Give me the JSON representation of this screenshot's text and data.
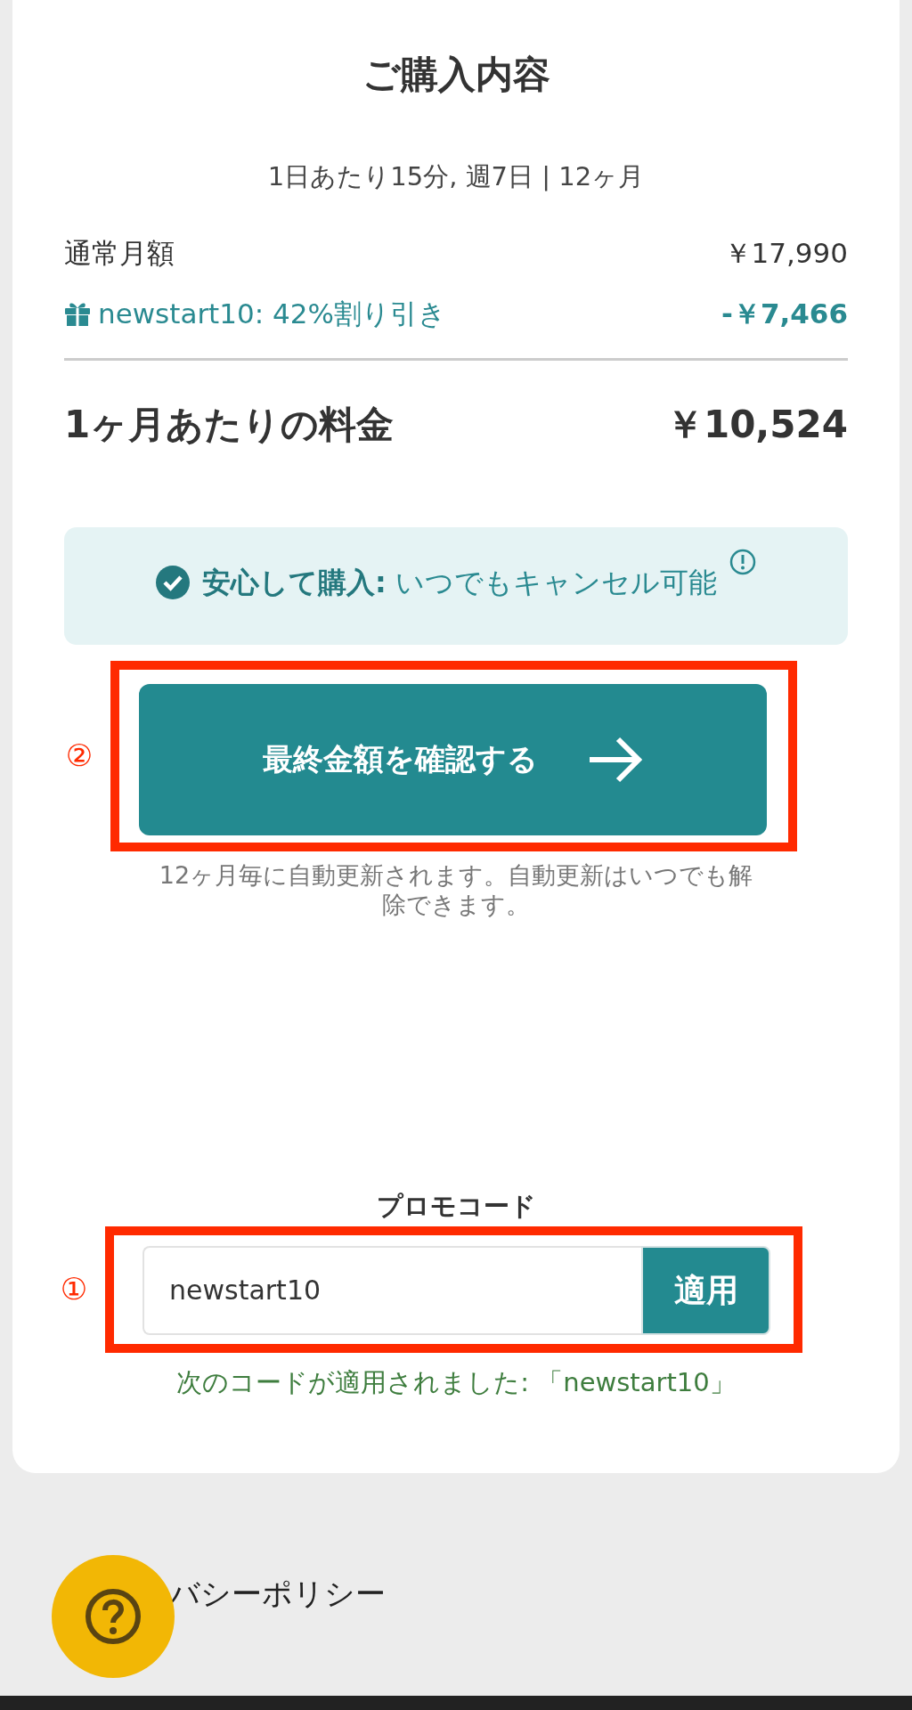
{
  "summary": {
    "title": "ご購入内容",
    "plan": "1日あたり15分, 週7日 | 12ヶ月",
    "lines": [
      {
        "kind": "regular",
        "label": "通常月額",
        "amount": "￥17,990"
      },
      {
        "kind": "discount",
        "label": "newstart10: 42%割り引き",
        "amount": "-￥7,466"
      }
    ],
    "total": {
      "label": "1ヶ月あたりの料金",
      "amount": "￥10,524"
    }
  },
  "guarantee": {
    "bold": "安心して購入:",
    "text": "いつでもキャンセル可能"
  },
  "confirm": {
    "marker": "②",
    "button": "最終金額を確認する",
    "note": "12ヶ月毎に自動更新されます。自動更新はいつでも解除できます。"
  },
  "promo": {
    "label": "プロモコード",
    "marker": "①",
    "value": "newstart10",
    "button": "適用",
    "message": "次のコードが適用されました: 「newstart10」"
  },
  "footer": {
    "link": "バシーポリシー"
  }
}
